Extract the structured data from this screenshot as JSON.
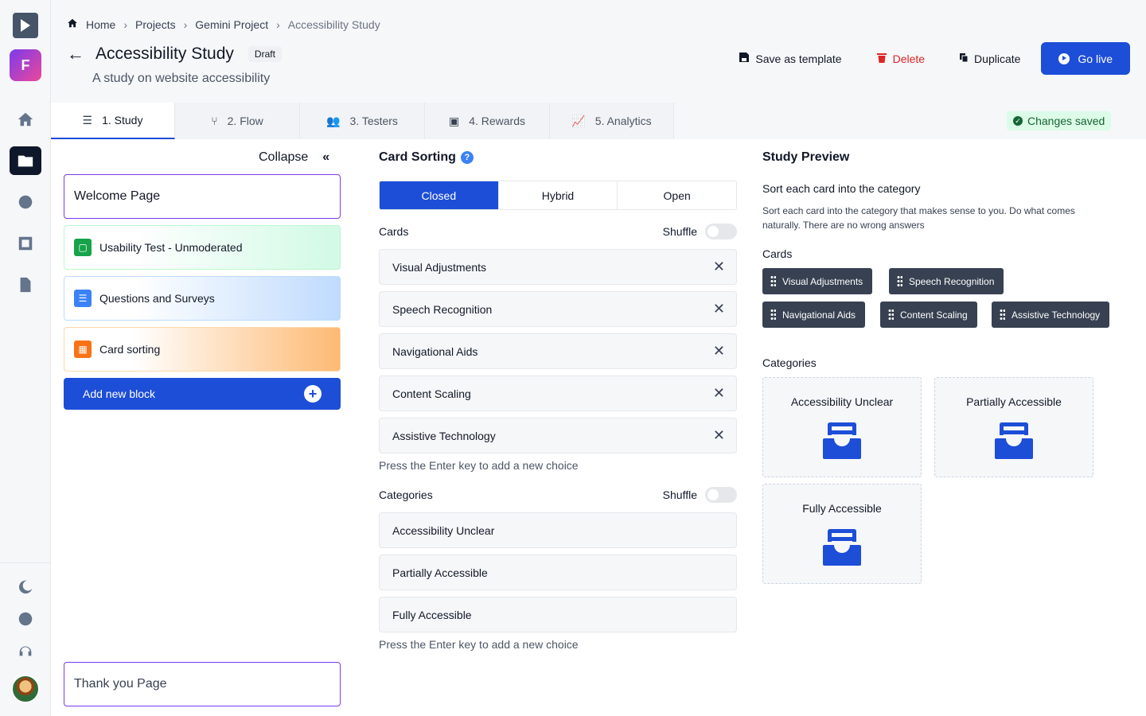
{
  "breadcrumb": {
    "home": "Home",
    "projects": "Projects",
    "project": "Gemini Project",
    "current": "Accessibility Study"
  },
  "header": {
    "title": "Accessibility Study",
    "badge": "Draft",
    "subtitle": "A study on website accessibility"
  },
  "actions": {
    "save_template": "Save as template",
    "delete": "Delete",
    "duplicate": "Duplicate",
    "go_live": "Go live"
  },
  "tabs": [
    {
      "label": "1. Study",
      "icon": "list-icon"
    },
    {
      "label": "2. Flow",
      "icon": "flow-icon"
    },
    {
      "label": "3. Testers",
      "icon": "users-icon"
    },
    {
      "label": "4. Rewards",
      "icon": "gift-icon"
    },
    {
      "label": "5. Analytics",
      "icon": "chart-icon"
    }
  ],
  "status": "Changes saved",
  "sidebar": {
    "collapse": "Collapse",
    "blocks": {
      "welcome": "Welcome Page",
      "usability": "Usability Test - Unmoderated",
      "questions": "Questions and Surveys",
      "cardsort": "Card sorting",
      "add_new": "Add new block",
      "thanks": "Thank you Page"
    }
  },
  "editor": {
    "title": "Card Sorting",
    "modes": [
      "Closed",
      "Hybrid",
      "Open"
    ],
    "selected_mode": "Closed",
    "cards_label": "Cards",
    "shuffle": "Shuffle",
    "cards": [
      "Visual Adjustments",
      "Speech Recognition",
      "Navigational Aids",
      "Content Scaling",
      "Assistive Technology"
    ],
    "hint": "Press the Enter key to add a new choice",
    "categories_label": "Categories",
    "categories": [
      "Accessibility Unclear",
      "Partially Accessible",
      "Fully Accessible"
    ]
  },
  "preview": {
    "title": "Study Preview",
    "question": "Sort each card into the category",
    "description": "Sort each card into the category that makes sense to you. Do what comes naturally. There are no wrong answers",
    "cards_label": "Cards",
    "cards": [
      "Visual Adjustments",
      "Speech Recognition",
      "Navigational Aids",
      "Content Scaling",
      "Assistive Technology"
    ],
    "categories_label": "Categories",
    "categories": [
      "Accessibility Unclear",
      "Partially Accessible",
      "Fully Accessible"
    ]
  },
  "colors": {
    "primary": "#1d4ed8",
    "danger": "#dc2626",
    "success_bg": "#dcfce7",
    "success_fg": "#166534",
    "block_border": "#7c3aed"
  }
}
